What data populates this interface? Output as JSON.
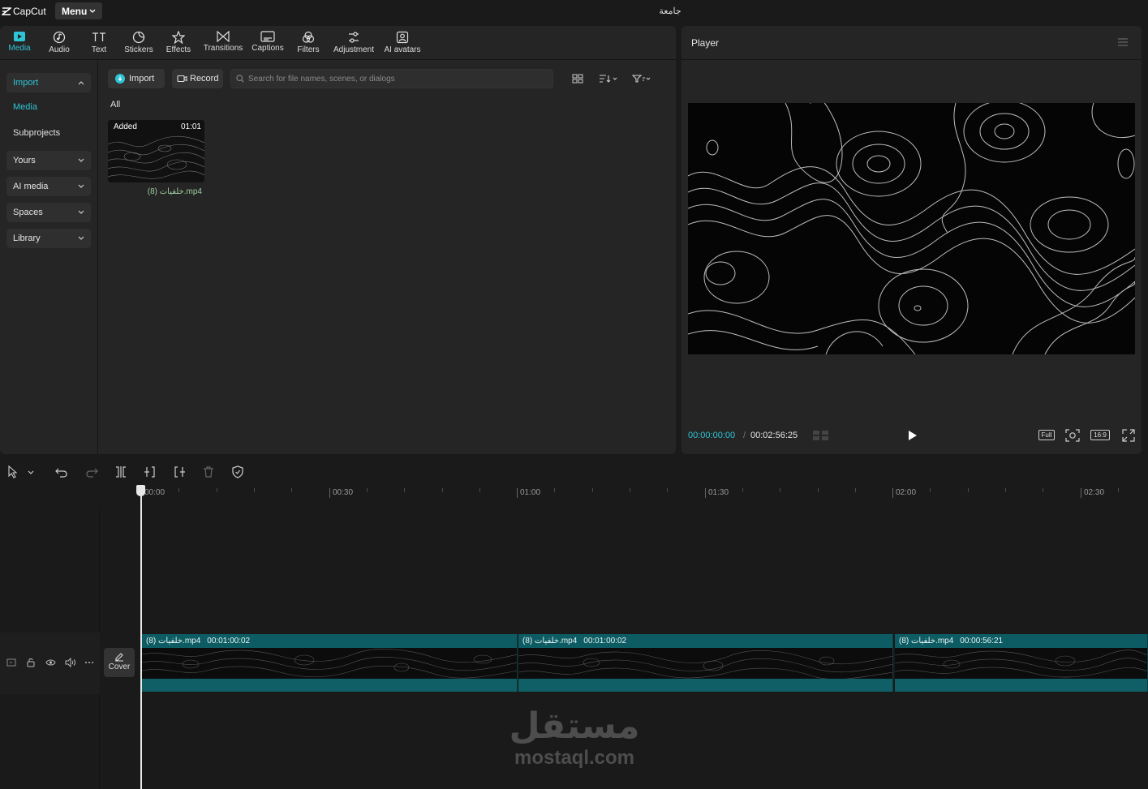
{
  "app": {
    "name": "CapCut",
    "menu_label": "Menu",
    "project_title": "جامعة"
  },
  "toolbar": {
    "items": [
      {
        "label": "Media",
        "icon": "media-icon",
        "active": true
      },
      {
        "label": "Audio",
        "icon": "audio-icon"
      },
      {
        "label": "Text",
        "icon": "text-icon"
      },
      {
        "label": "Stickers",
        "icon": "stickers-icon"
      },
      {
        "label": "Effects",
        "icon": "effects-icon"
      },
      {
        "label": "Transitions",
        "icon": "transitions-icon"
      },
      {
        "label": "Captions",
        "icon": "captions-icon"
      },
      {
        "label": "Filters",
        "icon": "filters-icon"
      },
      {
        "label": "Adjustment",
        "icon": "adjustment-icon"
      },
      {
        "label": "AI avatars",
        "icon": "ai-avatars-icon"
      }
    ]
  },
  "sidebar": {
    "import": "Import",
    "media": "Media",
    "subprojects": "Subprojects",
    "yours": "Yours",
    "ai_media": "AI media",
    "spaces": "Spaces",
    "library": "Library"
  },
  "media": {
    "import_button": "Import",
    "record_button": "Record",
    "search_placeholder": "Search for file names, scenes, or dialogs",
    "filter_label": "All",
    "item": {
      "badge": "Added",
      "duration": "01:01",
      "name": "خلفيات (8).mp4"
    }
  },
  "player": {
    "title": "Player",
    "current_time": "00:00:00:00",
    "total_time": "00:02:56:25",
    "full_label": "Full",
    "ratio_label": "16:9"
  },
  "timeline": {
    "ruler": [
      "00:00",
      "00:30",
      "01:00",
      "01:30",
      "02:00",
      "02:30"
    ],
    "cover_label": "Cover",
    "clips": [
      {
        "name": "خلفيات (8).mp4",
        "duration": "00:01:00:02"
      },
      {
        "name": "خلفيات (8).mp4",
        "duration": "00:01:00:02"
      },
      {
        "name": "خلفيات (8).mp4",
        "duration": "00:00:56:21"
      }
    ]
  },
  "watermark": {
    "arabic": "مستقل",
    "latin": "mostaql.com"
  },
  "colors": {
    "accent": "#2ec4d6",
    "clip": "#0d5c63",
    "panel": "#252525",
    "background": "#1a1a1a"
  }
}
